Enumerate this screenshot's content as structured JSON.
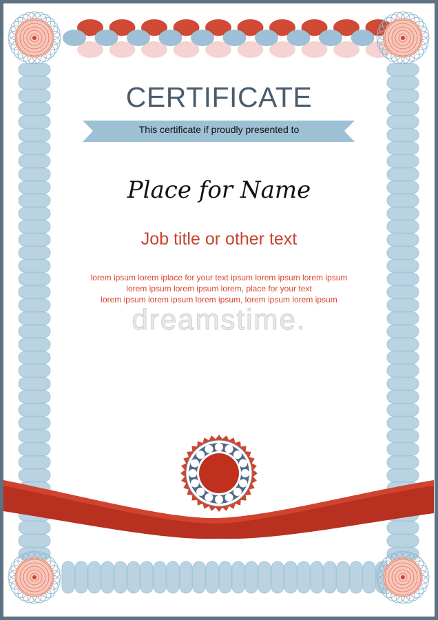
{
  "certificate": {
    "title": "CERTIFICATE",
    "subtitle": "This certificate if proudly presented to",
    "name": "Place for Name",
    "job_title": "Job title or other text",
    "body_lines": [
      "lorem ipsum lorem iplace for your text ipsum lorem ipsum lorem ipsum",
      "lorem ipsum lorem ipsum lorem, place for your text",
      "lorem ipsum lorem ipsum lorem ipsum, lorem ipsum lorem ipsum"
    ],
    "watermark": "dreamstime."
  },
  "colors": {
    "frame": "#5d7283",
    "light_blue": "#b9d3e2",
    "banner": "#9cc0d4",
    "red": "#c8432e",
    "ribbon": "#b8301f",
    "title": "#4a5c6d"
  }
}
